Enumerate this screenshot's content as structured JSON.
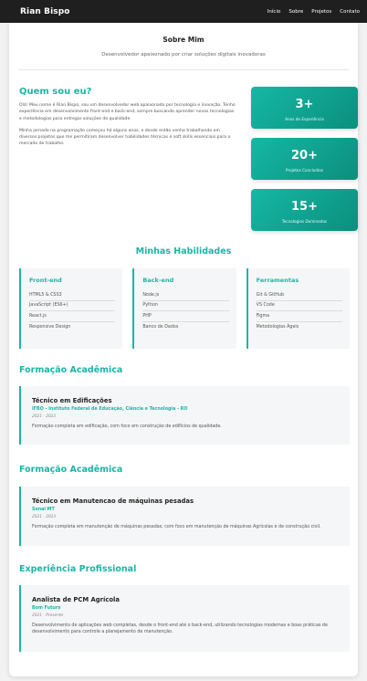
{
  "nav": {
    "brand": "Rian Bispo",
    "links": [
      "Início",
      "Sobre",
      "Projetos",
      "Contato"
    ]
  },
  "header": {
    "title": "Sobre Mim",
    "subtitle": "Desenvolvedor apaixonado por criar soluções digitais inovadoras"
  },
  "about": {
    "title": "Quem sou eu?",
    "p1": "Olá! Meu nome é Rian Bispo, sou um desenvolvedor web apaixonado por tecnologia e inovação. Tenho experiência em desenvolvimento front-end e back-end, sempre buscando aprender novas tecnologias e metodologias para entregar soluções de qualidade.",
    "p2": "Minha jornada na programação começou há alguns anos, e desde então venho trabalhando em diversos projetos que me permitiram desenvolver habilidades técnicas e soft skills essenciais para o mercado de trabalho."
  },
  "stats": [
    {
      "value": "3+",
      "label": "Anos de Experiência"
    },
    {
      "value": "20+",
      "label": "Projetos Concluídos"
    },
    {
      "value": "15+",
      "label": "Tecnologias Dominadas"
    }
  ],
  "skills": {
    "title": "Minhas Habilidades",
    "columns": [
      {
        "title": "Front-end",
        "items": [
          "HTML5 & CSS3",
          "JavaScript (ES6+)",
          "React.js",
          "Responsive Design"
        ]
      },
      {
        "title": "Back-end",
        "items": [
          "Node.js",
          "Python",
          "PHP",
          "Banco de Dados"
        ]
      },
      {
        "title": "Ferramentas",
        "items": [
          "Git & GitHub",
          "VS Code",
          "Figma",
          "Metodologias Ágeis"
        ]
      }
    ]
  },
  "education1": {
    "title": "Formação Acadêmica",
    "course": "Técnico em Edificações",
    "institution": "IFBO - Instituto Federal de Educação, Ciência e Tecnologia - RO",
    "period": "2021 - 2023",
    "description": "Formação completa em edificação, com foco em construção de edifícios de qualidade."
  },
  "education2": {
    "title": "Formação Acadêmica",
    "course": "Técnico em Manutencao de máquinas pesadas",
    "institution": "Senai MT",
    "period": "2021 - 2023",
    "description": "Formação completa em manutenção de máquinas pesadas, com foco em manutenção de máquinas Agrícolas e de construção civil."
  },
  "experience": {
    "title": "Experiência Profissional",
    "role": "Analista de PCM Agrícola",
    "company": "Bom Futuro",
    "period": "2021 - Presente",
    "description": "Desenvolvimento de aplicações web completas, desde o front-end até o back-end, utilizando tecnologias modernas e boas práticas de desenvolvimento para controle a planejamento de manutenção."
  }
}
